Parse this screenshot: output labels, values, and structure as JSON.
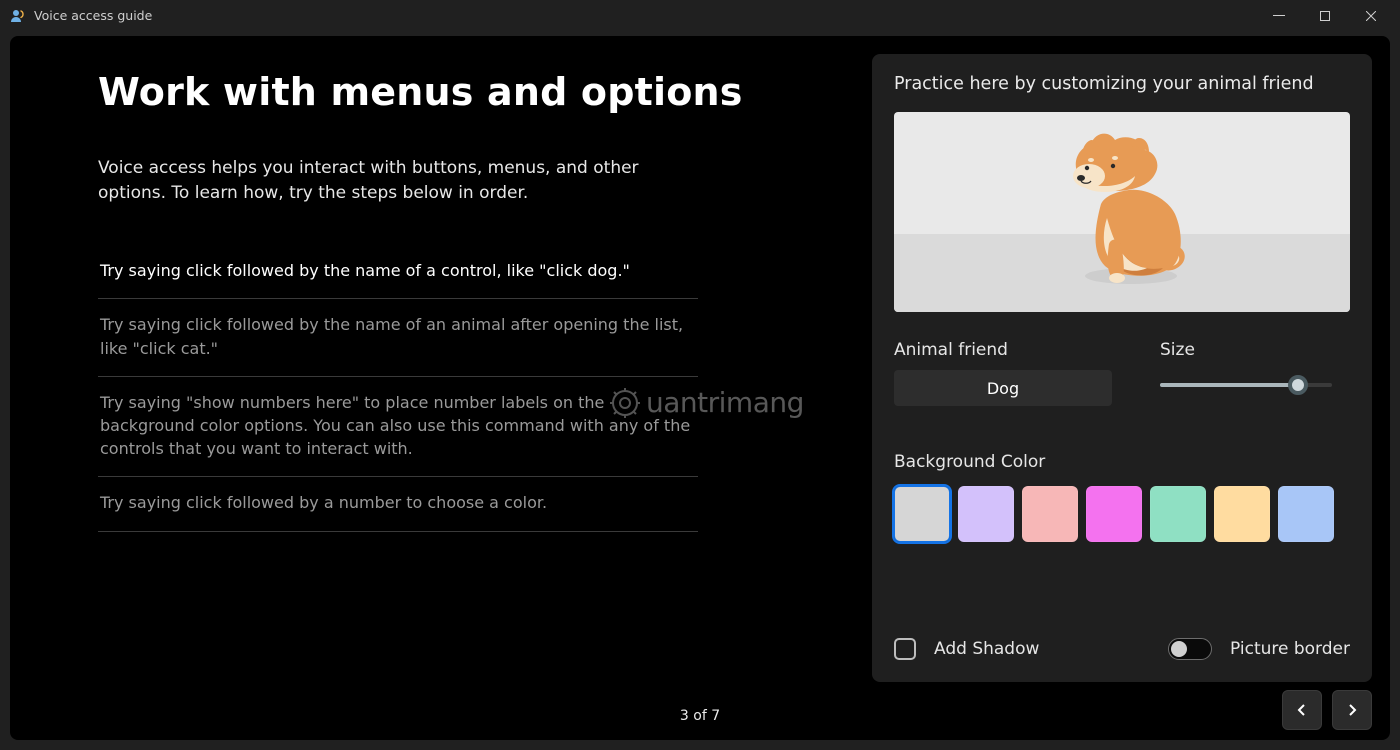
{
  "titlebar": {
    "title": "Voice access guide"
  },
  "left": {
    "heading": "Work with menus and options",
    "intro": "Voice access helps you interact with buttons, menus, and other options. To learn how, try the steps below in order.",
    "steps": [
      "Try saying click followed by the name of a control, like \"click dog.\"",
      "Try saying click followed by the name of an animal after opening the list, like \"click cat.\"",
      "Try saying \"show numbers here\" to place number labels on the background color options. You can also use this command with any of the controls that you want to interact with.",
      "Try saying click followed by a number to choose a color."
    ],
    "active_step_index": 0
  },
  "right": {
    "practice_title": "Practice here by customizing your animal friend",
    "animal_label": "Animal friend",
    "animal_value": "Dog",
    "size_label": "Size",
    "size_percent": 80,
    "bgcolor_label": "Background Color",
    "swatches": [
      {
        "hex": "#d6d6d6",
        "selected": true
      },
      {
        "hex": "#d3c1fb",
        "selected": false
      },
      {
        "hex": "#f7b7b7",
        "selected": false
      },
      {
        "hex": "#f472ef",
        "selected": false
      },
      {
        "hex": "#8fe0c3",
        "selected": false
      },
      {
        "hex": "#ffdca0",
        "selected": false
      },
      {
        "hex": "#a8c6f7",
        "selected": false
      }
    ],
    "add_shadow_label": "Add Shadow",
    "add_shadow_checked": false,
    "picture_border_label": "Picture border",
    "picture_border_on": false
  },
  "footer": {
    "page_text": "3 of 7"
  },
  "watermark": {
    "text": "uantrimang"
  }
}
